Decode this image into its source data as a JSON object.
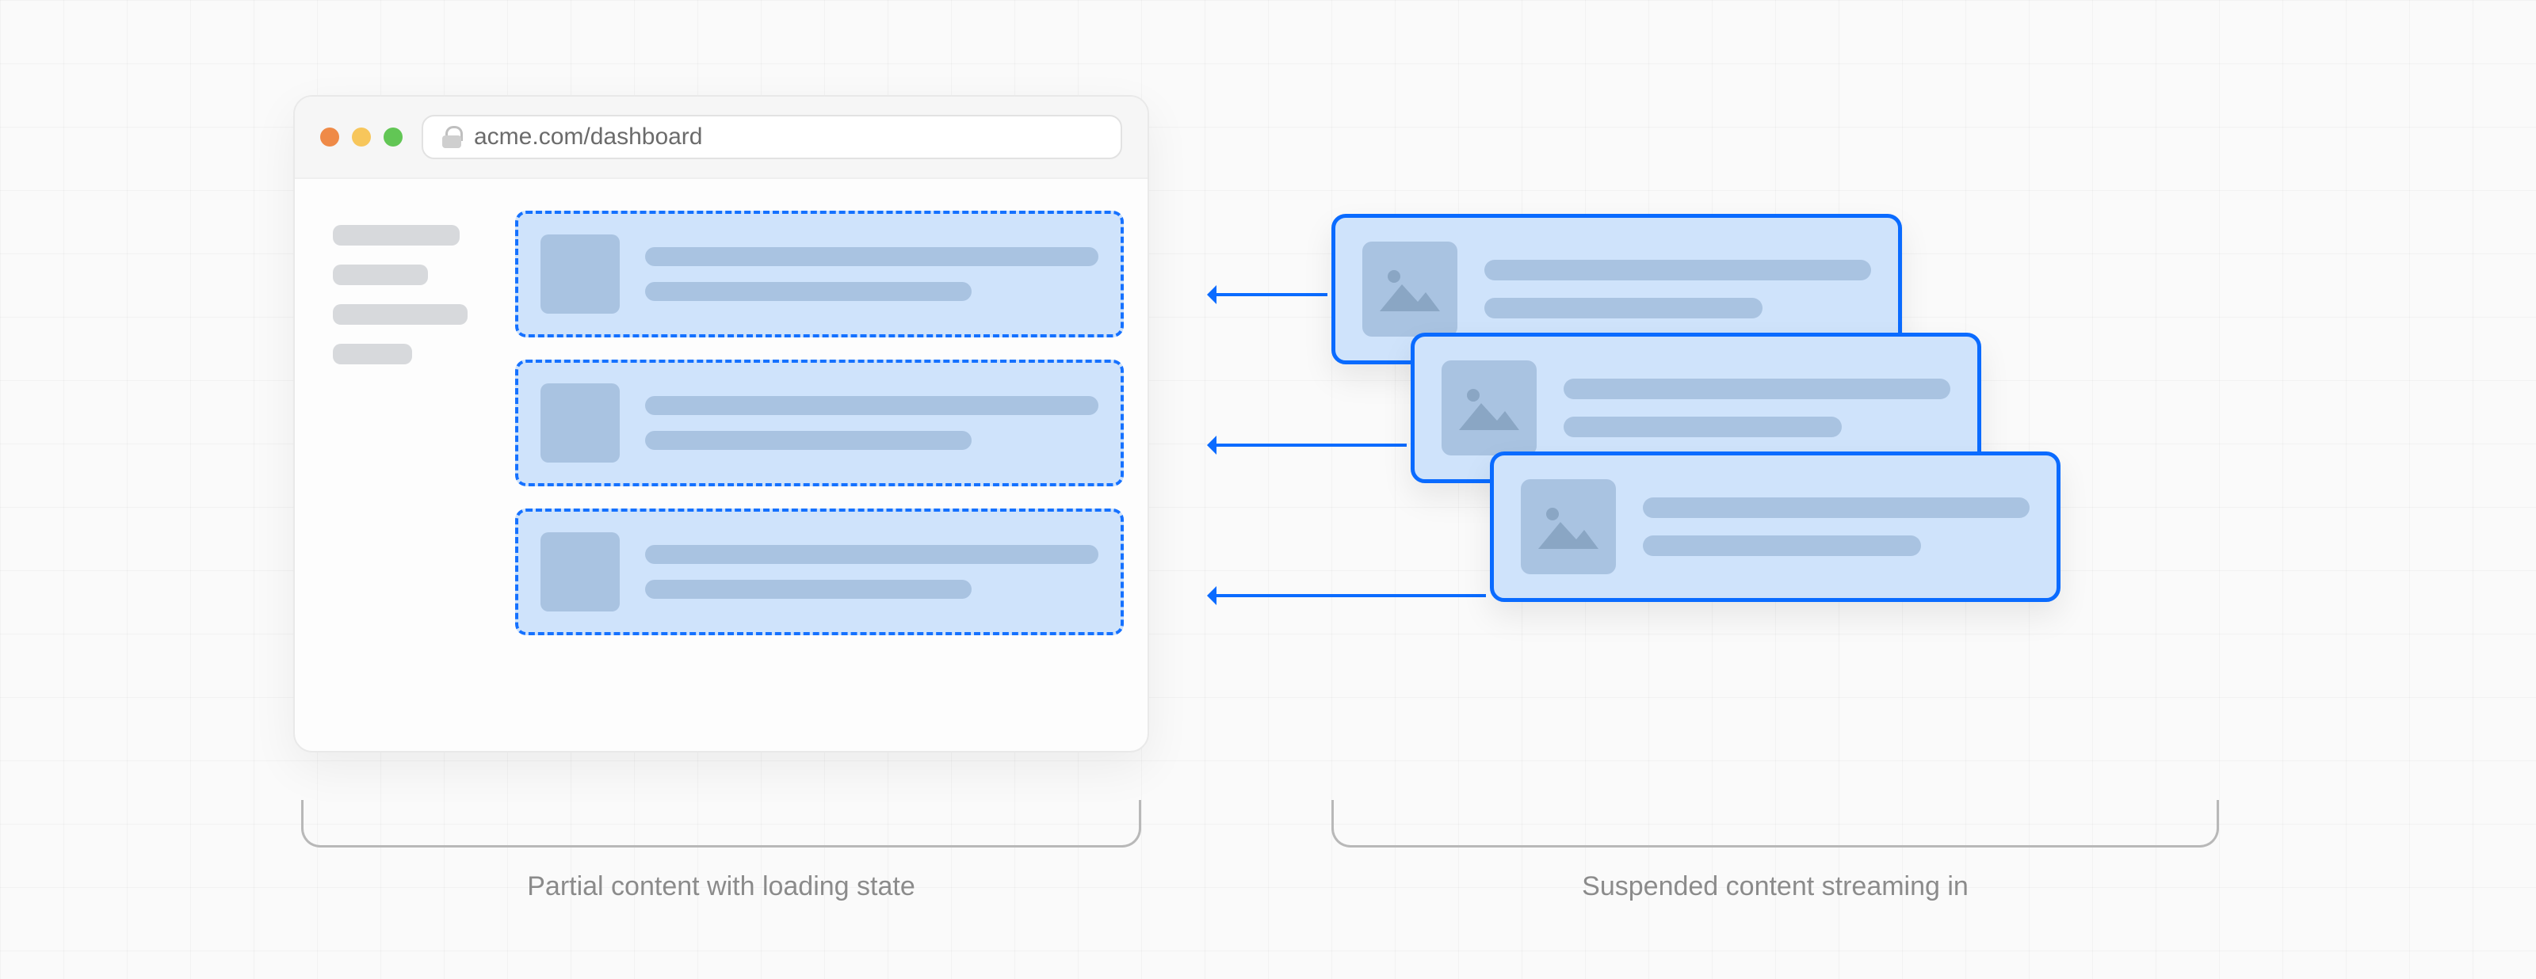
{
  "browser": {
    "url": "acme.com/dashboard",
    "traffic_colors": [
      "#ef8a47",
      "#f7c65b",
      "#62c655"
    ],
    "sidebar_item_count": 4,
    "skeleton_card_count": 3
  },
  "streaming": {
    "card_count": 3,
    "arrow_count": 3,
    "border_color": "#0a6bff",
    "fill_color": "#cfe3fb"
  },
  "captions": {
    "left": "Partial content with loading state",
    "right": "Suspended content streaming in"
  }
}
